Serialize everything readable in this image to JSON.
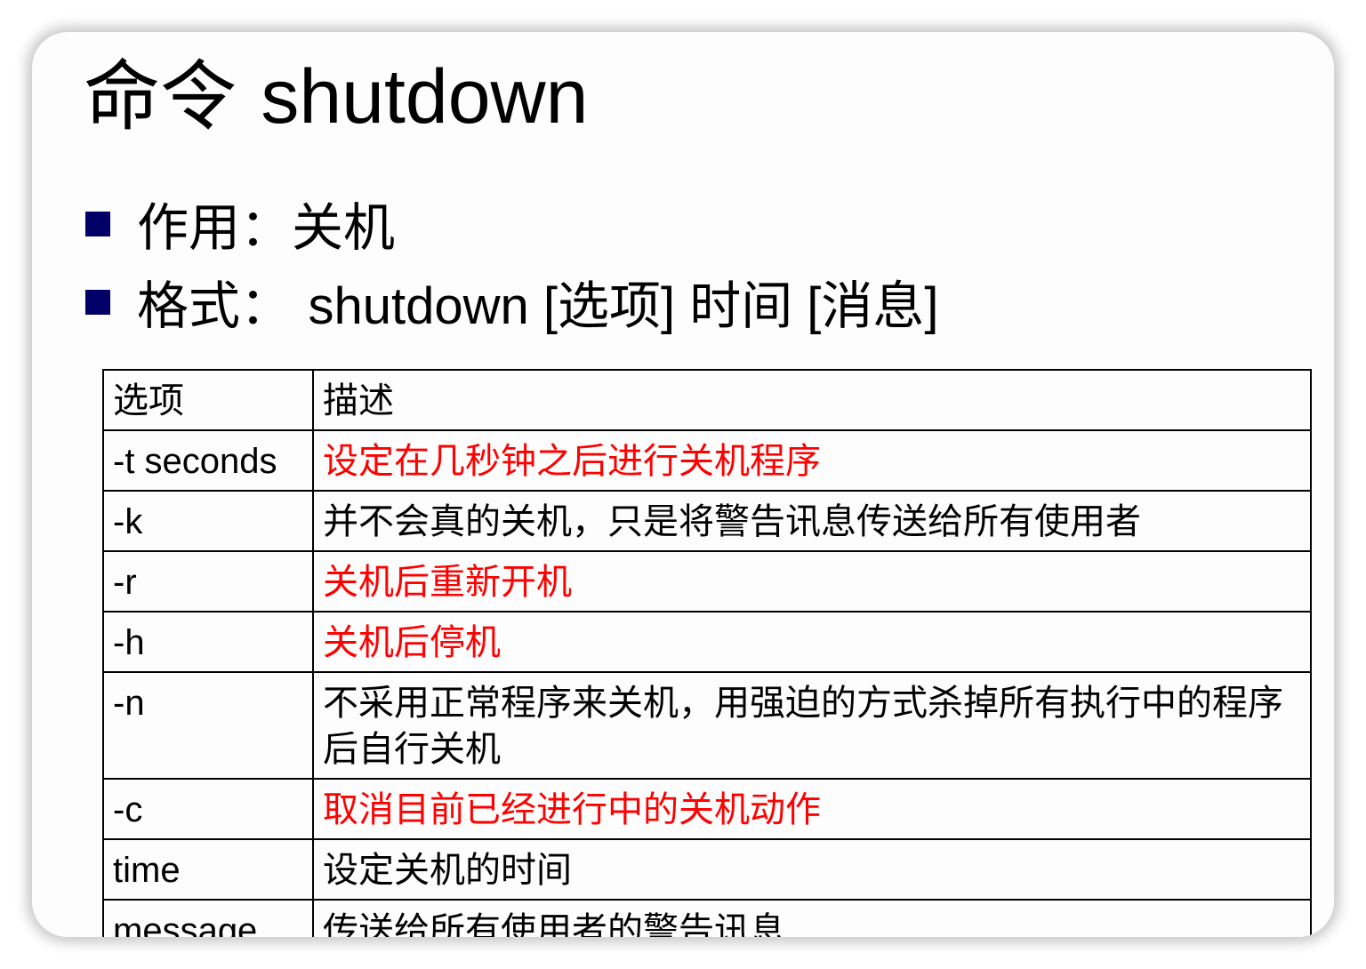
{
  "title": {
    "cn": "命令",
    "en": "shutdown"
  },
  "bullets": [
    {
      "label": "作用：",
      "text": "关机"
    },
    {
      "label": "格式：",
      "text": "shutdown [选项] 时间 [消息]"
    }
  ],
  "table": {
    "header": {
      "option": "选项",
      "description": "描述"
    },
    "rows": [
      {
        "option": "-t seconds",
        "description": "设定在几秒钟之后进行关机程序",
        "highlight": true
      },
      {
        "option": "-k",
        "description": "并不会真的关机，只是将警告讯息传送给所有使用者",
        "highlight": false
      },
      {
        "option": "-r",
        "description": "关机后重新开机",
        "highlight": true
      },
      {
        "option": "-h",
        "description": "关机后停机",
        "highlight": true
      },
      {
        "option": "-n",
        "description": "不采用正常程序来关机，用强迫的方式杀掉所有执行中的程序后自行关机",
        "highlight": false
      },
      {
        "option": "-c",
        "description": "取消目前已经进行中的关机动作",
        "highlight": true
      },
      {
        "option": "time",
        "description": "设定关机的时间",
        "highlight": false
      },
      {
        "option": "message",
        "description": "传送给所有使用者的警告讯息",
        "highlight": false
      }
    ]
  },
  "colors": {
    "bullet_marker": "#000066",
    "highlight_text": "#ff0000",
    "normal_text": "#000000"
  }
}
